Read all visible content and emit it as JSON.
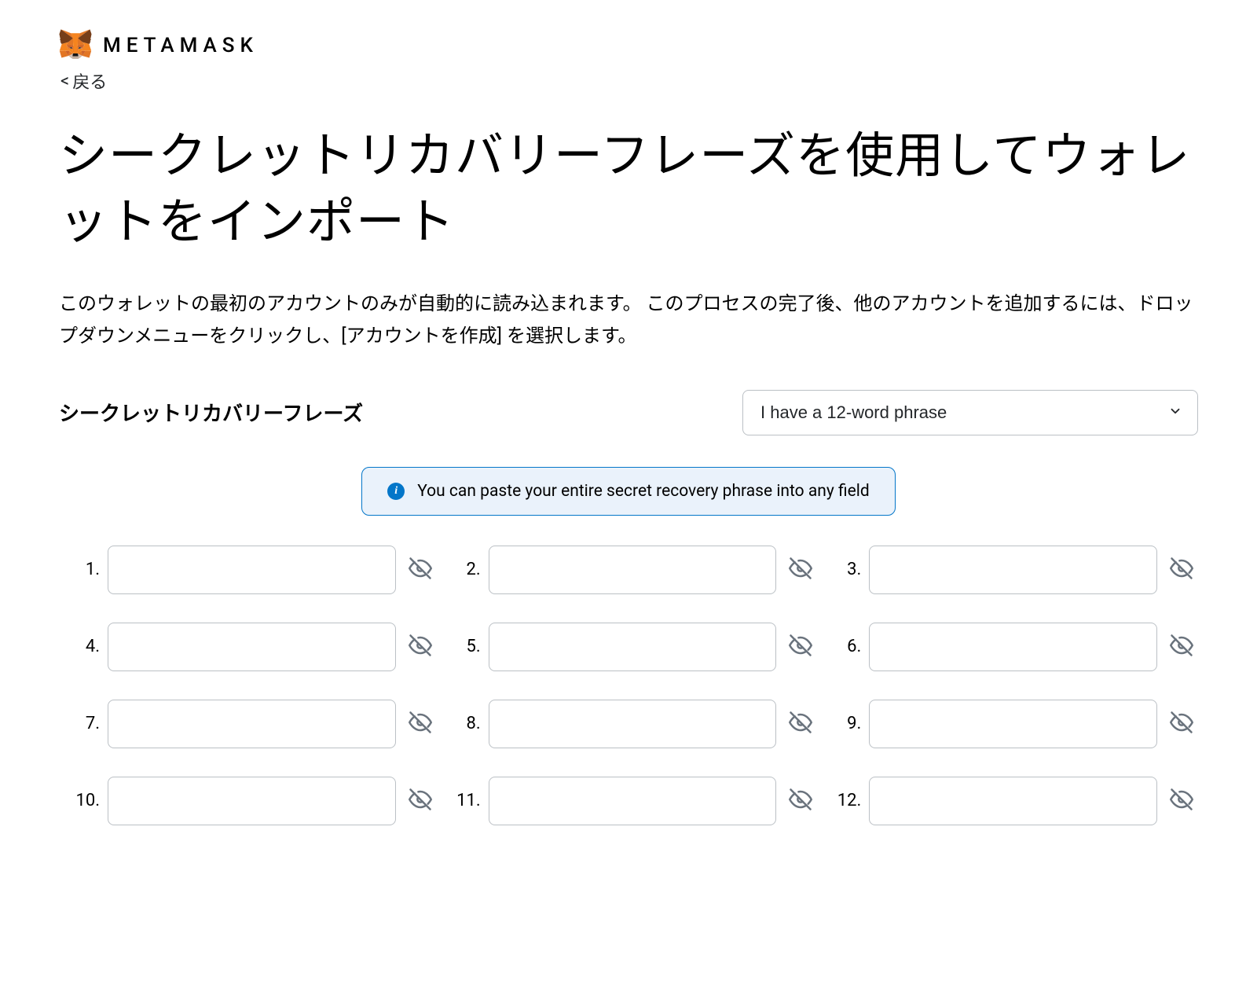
{
  "brand": "METAMASK",
  "back_label": "戻る",
  "page_title": "シークレットリカバリーフレーズを使用してウォレットをインポート",
  "description": "このウォレットの最初のアカウントのみが自動的に読み込まれます。 このプロセスの完了後、他のアカウントを追加するには、ドロップダウンメニューをクリックし、[アカウントを作成] を選択します。",
  "srp_label": "シークレットリカバリーフレーズ",
  "word_count_selected": "I have a 12-word phrase",
  "info_text": "You can paste your entire secret recovery phrase into any field",
  "words": [
    {
      "n": "1.",
      "value": ""
    },
    {
      "n": "2.",
      "value": ""
    },
    {
      "n": "3.",
      "value": ""
    },
    {
      "n": "4.",
      "value": ""
    },
    {
      "n": "5.",
      "value": ""
    },
    {
      "n": "6.",
      "value": ""
    },
    {
      "n": "7.",
      "value": ""
    },
    {
      "n": "8.",
      "value": ""
    },
    {
      "n": "9.",
      "value": ""
    },
    {
      "n": "10.",
      "value": ""
    },
    {
      "n": "11.",
      "value": ""
    },
    {
      "n": "12.",
      "value": ""
    }
  ]
}
